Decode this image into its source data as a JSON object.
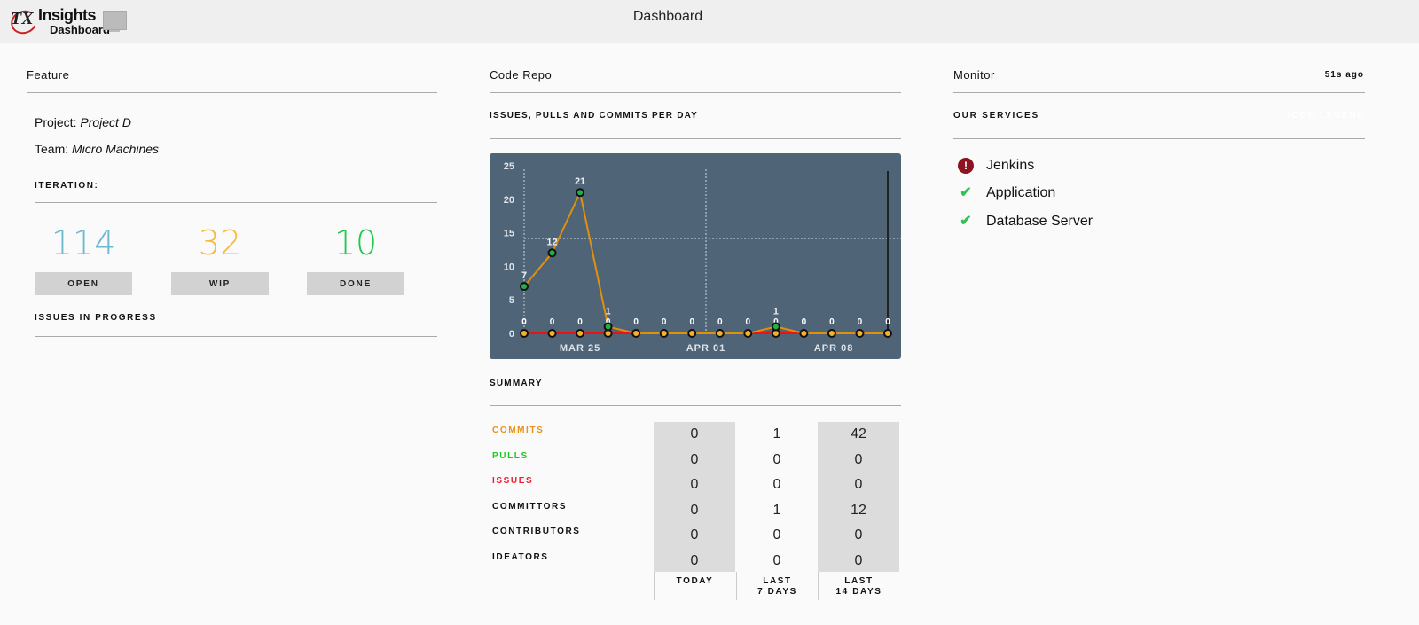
{
  "header": {
    "logo_text_1": "Insights",
    "logo_text_2": "Dashboard",
    "logo_mark": "TX",
    "title": "Dashboard"
  },
  "feature": {
    "title": "Feature",
    "project_label": "Project:",
    "project_value": "Project D",
    "team_label": "Team:",
    "team_value": "Micro Machines",
    "iteration_label": "ITERATION:",
    "stats": [
      {
        "value": "114",
        "label": "OPEN",
        "color": "#6bb8cf"
      },
      {
        "value": "32",
        "label": "WIP",
        "color": "#f9b83a"
      },
      {
        "value": "10",
        "label": "DONE",
        "color": "#1ec94f"
      }
    ],
    "issues_label": "ISSUES IN PROGRESS"
  },
  "code_repo": {
    "title": "Code Repo",
    "chart_title": "ISSUES, PULLS AND COMMITS PER DAY",
    "summary_title": "SUMMARY",
    "summary_rows": [
      {
        "label": "COMMITS",
        "color": "#e8921a",
        "values": [
          "0",
          "1",
          "42"
        ]
      },
      {
        "label": "PULLS",
        "color": "#1ec91e",
        "values": [
          "0",
          "0",
          "0"
        ]
      },
      {
        "label": "ISSUES",
        "color": "#ee1c2e",
        "values": [
          "0",
          "0",
          "0"
        ]
      },
      {
        "label": "COMMITTORS",
        "color": "#111111",
        "values": [
          "0",
          "1",
          "12"
        ]
      },
      {
        "label": "CONTRIBUTORS",
        "color": "#111111",
        "values": [
          "0",
          "0",
          "0"
        ]
      },
      {
        "label": "IDEATORS",
        "color": "#111111",
        "values": [
          "0",
          "0",
          "0"
        ]
      }
    ],
    "summary_columns": [
      [
        "TODAY"
      ],
      [
        "LAST",
        "7 DAYS"
      ],
      [
        "LAST",
        "14 DAYS"
      ]
    ]
  },
  "chart_data": {
    "type": "line",
    "ylim": [
      0,
      25
    ],
    "yticks": [
      "0",
      "5",
      "10",
      "15",
      "20",
      "25"
    ],
    "xtick_labels": [
      "MAR 25",
      "APR 01",
      "APR 08"
    ],
    "grid": true,
    "series": [
      {
        "key": "commits",
        "values": [
          7,
          12,
          21,
          1,
          0,
          0,
          0,
          0,
          0,
          1,
          0,
          0,
          0,
          0
        ],
        "color": "#e0900a",
        "point_color": "#1fb04a"
      },
      {
        "key": "pulls",
        "values": [
          0,
          0,
          0,
          0,
          0,
          0,
          0,
          0,
          0,
          0,
          0,
          0,
          0,
          0
        ],
        "color": "#f5b030"
      },
      {
        "key": "issues",
        "values": [
          0,
          0,
          0,
          0,
          0,
          0,
          0,
          0,
          0,
          0,
          0,
          0,
          0,
          0
        ],
        "color": "#ee1111"
      }
    ]
  },
  "monitor": {
    "title": "Monitor",
    "updated": "51s ago",
    "services_title": "OUR SERVICES",
    "legend_label": "ICON LEGEND",
    "services": [
      {
        "name": "Jenkins",
        "status": "error",
        "icon": "!"
      },
      {
        "name": "Application",
        "status": "ok",
        "icon": "✔"
      },
      {
        "name": "Database Server",
        "status": "ok",
        "icon": "✔"
      }
    ]
  }
}
